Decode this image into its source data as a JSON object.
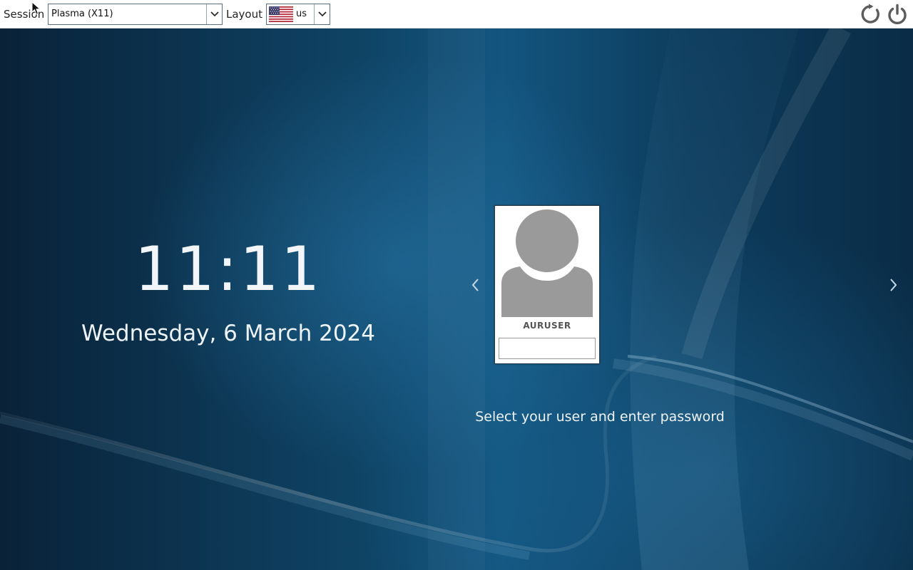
{
  "topbar": {
    "session_label": "Session",
    "session_value": "Plasma (X11)",
    "layout_label": "Layout",
    "layout_value": "us",
    "layout_flag_icon": "us-flag-icon",
    "reboot_icon": "reboot-icon",
    "shutdown_icon": "power-icon"
  },
  "clock": {
    "time": "11:11",
    "date": "Wednesday, 6 March 2024"
  },
  "user_selector": {
    "username": "AURUSER",
    "password_value": "",
    "prev_icon": "chevron-left-icon",
    "next_icon": "chevron-right-icon",
    "hint": "Select your user and enter password"
  },
  "colors": {
    "topbar_bg": "#ffffff",
    "wallpaper_base": "#0f4466",
    "avatar_gray": "#9a9a9a",
    "text_light": "#eef3f6"
  }
}
